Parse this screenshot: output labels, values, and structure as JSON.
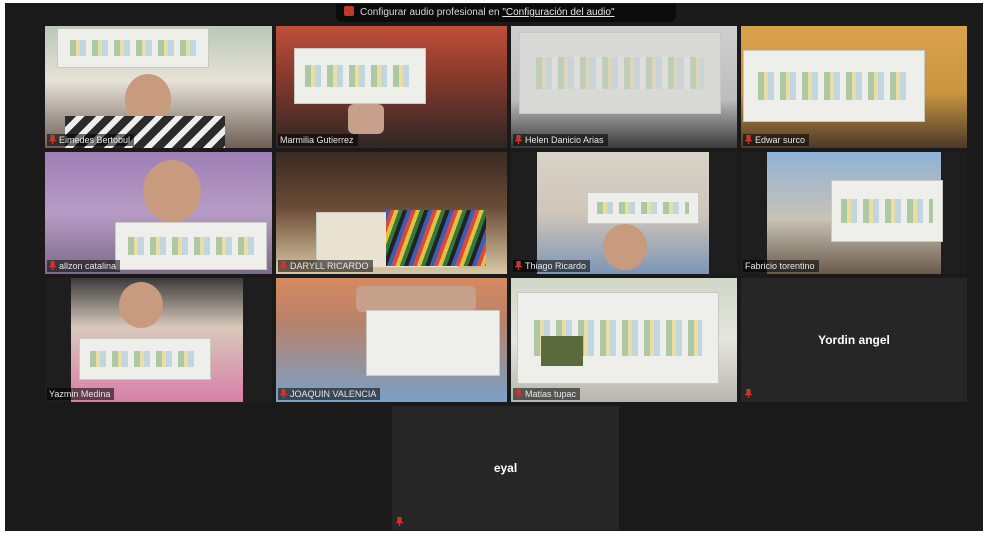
{
  "banner": {
    "text": "Configurar audio profesional en ",
    "link": "\"Configuración del audio\""
  },
  "participants": [
    {
      "name": "Eimedes Bertobul",
      "muted": true
    },
    {
      "name": "Marmilia Gutierrez",
      "muted": false,
      "active_speaker": true
    },
    {
      "name": "Helen Danicio Arias",
      "muted": true
    },
    {
      "name": "Edwar surco",
      "muted": true
    },
    {
      "name": "allzon catalina",
      "muted": true
    },
    {
      "name": "DARYLL RICARDO",
      "muted": true
    },
    {
      "name": "Thiago Ricardo",
      "muted": true
    },
    {
      "name": "Fabricio torentino",
      "muted": false
    },
    {
      "name": "Yazmin Medina",
      "muted": false
    },
    {
      "name": "JOAQUIN VALENCIA",
      "muted": true
    },
    {
      "name": "Matias tupac",
      "muted": true
    },
    {
      "name": "Yordin angel",
      "muted": true,
      "video_off": true
    },
    {
      "name": "eyal",
      "muted": true,
      "video_off": true
    }
  ],
  "colors": {
    "background": "#1a1a1a",
    "tile": "#262626",
    "active_outline": "#c7d36a",
    "mute_red": "#d0342c"
  }
}
